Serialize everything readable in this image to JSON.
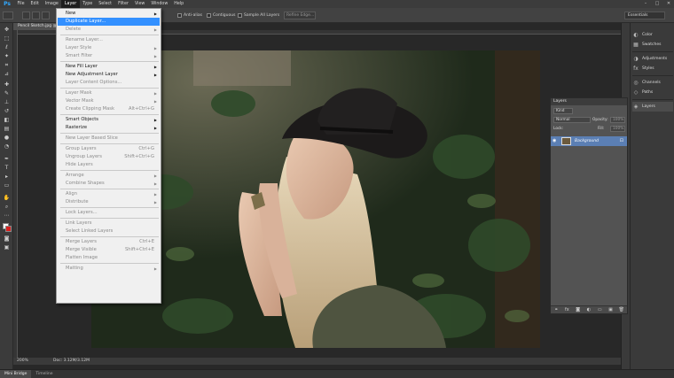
{
  "app": {
    "logo": "Ps"
  },
  "menubar": {
    "items": [
      "File",
      "Edit",
      "Image",
      "Layer",
      "Type",
      "Select",
      "Filter",
      "View",
      "Window",
      "Help"
    ],
    "active": "Layer",
    "window_controls": [
      "–",
      "□",
      "✕"
    ]
  },
  "options_bar": {
    "tool_size": "⬚",
    "anti_alias_label": "Anti-alias",
    "contiguous_label": "Contiguous",
    "sample_all_layers_label": "Sample All Layers",
    "refine_edge_label": "Refine Edge...",
    "workspace": "Essentials"
  },
  "document": {
    "tab_title": "Pencil Sketch.jpg @",
    "tab_close": "×",
    "zoom": "200%",
    "doc_info": "Doc: 3.12M/3.12M"
  },
  "bottom_tabs": [
    "Mini Bridge",
    "Timeline"
  ],
  "layer_menu": {
    "items": [
      {
        "label": "New",
        "shortcut": "",
        "submenu": true,
        "disabled": false,
        "highlighted": false
      },
      {
        "label": "Duplicate Layer...",
        "shortcut": "",
        "submenu": false,
        "disabled": false,
        "highlighted": true
      },
      {
        "label": "Delete",
        "shortcut": "",
        "submenu": true,
        "disabled": true,
        "highlighted": false
      },
      {
        "sep": true
      },
      {
        "label": "Rename Layer...",
        "shortcut": "",
        "submenu": false,
        "disabled": true,
        "highlighted": false
      },
      {
        "label": "Layer Style",
        "shortcut": "",
        "submenu": true,
        "disabled": true,
        "highlighted": false
      },
      {
        "label": "Smart Filter",
        "shortcut": "",
        "submenu": true,
        "disabled": true,
        "highlighted": false
      },
      {
        "sep": true
      },
      {
        "label": "New Fill Layer",
        "shortcut": "",
        "submenu": true,
        "disabled": false,
        "highlighted": false
      },
      {
        "label": "New Adjustment Layer",
        "shortcut": "",
        "submenu": true,
        "disabled": false,
        "highlighted": false
      },
      {
        "label": "Layer Content Options...",
        "shortcut": "",
        "submenu": false,
        "disabled": true,
        "highlighted": false
      },
      {
        "sep": true
      },
      {
        "label": "Layer Mask",
        "shortcut": "",
        "submenu": true,
        "disabled": true,
        "highlighted": false
      },
      {
        "label": "Vector Mask",
        "shortcut": "",
        "submenu": true,
        "disabled": true,
        "highlighted": false
      },
      {
        "label": "Create Clipping Mask",
        "shortcut": "Alt+Ctrl+G",
        "submenu": false,
        "disabled": true,
        "highlighted": false
      },
      {
        "sep": true
      },
      {
        "label": "Smart Objects",
        "shortcut": "",
        "submenu": true,
        "disabled": false,
        "highlighted": false
      },
      {
        "label": "Rasterize",
        "shortcut": "",
        "submenu": true,
        "disabled": false,
        "highlighted": false
      },
      {
        "sep": true
      },
      {
        "label": "New Layer Based Slice",
        "shortcut": "",
        "submenu": false,
        "disabled": true,
        "highlighted": false
      },
      {
        "sep": true
      },
      {
        "label": "Group Layers",
        "shortcut": "Ctrl+G",
        "submenu": false,
        "disabled": true,
        "highlighted": false
      },
      {
        "label": "Ungroup Layers",
        "shortcut": "Shift+Ctrl+G",
        "submenu": false,
        "disabled": true,
        "highlighted": false
      },
      {
        "label": "Hide Layers",
        "shortcut": "",
        "submenu": false,
        "disabled": true,
        "highlighted": false
      },
      {
        "sep": true
      },
      {
        "label": "Arrange",
        "shortcut": "",
        "submenu": true,
        "disabled": true,
        "highlighted": false
      },
      {
        "label": "Combine Shapes",
        "shortcut": "",
        "submenu": true,
        "disabled": true,
        "highlighted": false
      },
      {
        "sep": true
      },
      {
        "label": "Align",
        "shortcut": "",
        "submenu": true,
        "disabled": true,
        "highlighted": false
      },
      {
        "label": "Distribute",
        "shortcut": "",
        "submenu": true,
        "disabled": true,
        "highlighted": false
      },
      {
        "sep": true
      },
      {
        "label": "Lock Layers...",
        "shortcut": "",
        "submenu": false,
        "disabled": true,
        "highlighted": false
      },
      {
        "sep": true
      },
      {
        "label": "Link Layers",
        "shortcut": "",
        "submenu": false,
        "disabled": true,
        "highlighted": false
      },
      {
        "label": "Select Linked Layers",
        "shortcut": "",
        "submenu": false,
        "disabled": true,
        "highlighted": false
      },
      {
        "sep": true
      },
      {
        "label": "Merge Layers",
        "shortcut": "Ctrl+E",
        "submenu": false,
        "disabled": true,
        "highlighted": false
      },
      {
        "label": "Merge Visible",
        "shortcut": "Shift+Ctrl+E",
        "submenu": false,
        "disabled": true,
        "highlighted": false
      },
      {
        "label": "Flatten Image",
        "shortcut": "",
        "submenu": false,
        "disabled": true,
        "highlighted": false
      },
      {
        "sep": true
      },
      {
        "label": "Matting",
        "shortcut": "",
        "submenu": true,
        "disabled": true,
        "highlighted": false
      }
    ]
  },
  "dock": {
    "items": [
      {
        "label": "Color",
        "icon": "color-icon",
        "glyph": "◐"
      },
      {
        "label": "Swatches",
        "icon": "swatches-icon",
        "glyph": "▦"
      },
      {
        "label": "Adjustments",
        "icon": "adjustments-icon",
        "glyph": "◑"
      },
      {
        "label": "Styles",
        "icon": "styles-icon",
        "glyph": "fx"
      },
      {
        "label": "Channels",
        "icon": "channels-icon",
        "glyph": "◎"
      },
      {
        "label": "Paths",
        "icon": "paths-icon",
        "glyph": "◇"
      },
      {
        "label": "Layers",
        "icon": "layers-icon",
        "glyph": "◈"
      }
    ],
    "selected": "Layers"
  },
  "layers_panel": {
    "title": "Layers",
    "filter_kind": "Kind",
    "blend_mode": "Normal",
    "opacity_label": "Opacity:",
    "opacity_value": "100%",
    "lock_label": "Lock:",
    "fill_label": "Fill:",
    "fill_value": "100%",
    "layer_name": "Background",
    "footer_icons": [
      "link-icon",
      "fx-icon",
      "mask-icon",
      "adjustment-icon",
      "folder-icon",
      "new-layer-icon",
      "trash-icon"
    ],
    "footer_glyphs": [
      "⚭",
      "fx",
      "◙",
      "◐",
      "▭",
      "▣",
      "🗑"
    ]
  },
  "colors": {
    "highlight": "#3390ff",
    "layer_selected": "#5b7fb4",
    "ps_blue": "#31a8ff"
  }
}
